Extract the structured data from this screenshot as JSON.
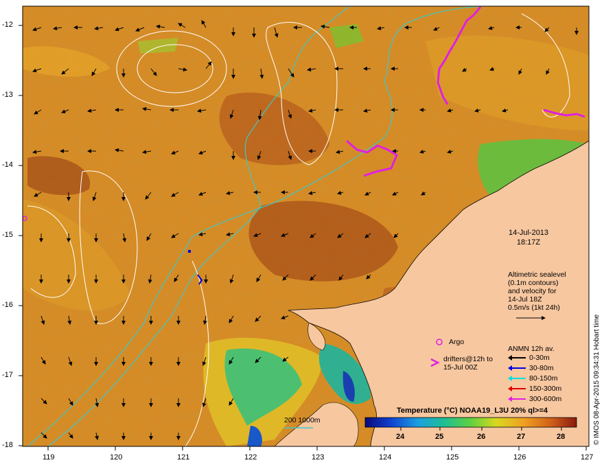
{
  "map": {
    "date": "14-Jul-2013",
    "time": "18:17Z",
    "lon_ticks": [
      "119",
      "120",
      "121",
      "122",
      "123",
      "124",
      "125",
      "126",
      "127"
    ],
    "lat_ticks": [
      "-12",
      "-13",
      "-14",
      "-15",
      "-16",
      "-17",
      "-18"
    ],
    "lon_range": [
      118.6,
      127.0
    ],
    "lat_range": [
      -18.0,
      -11.8
    ]
  },
  "altimetry_note": {
    "line1": "Altimetric sealevel",
    "line2": "(0.1m contours)",
    "line3": "and velocity for",
    "line4": "14-Jul 18Z",
    "line5": "0.5m/s (1kt 24h)"
  },
  "argo": {
    "label": "Argo",
    "color": "#e020e0"
  },
  "drifters": {
    "line1": "drifters@12h to",
    "line2": "15-Jul 00Z",
    "symbol": ">",
    "color": "#e020e0"
  },
  "anmn": {
    "title": "ANMN 12h av.",
    "items": [
      {
        "label": "0-30m",
        "color": "#000000"
      },
      {
        "label": "30-80m",
        "color": "#0000e0"
      },
      {
        "label": "80-150m",
        "color": "#00e0e0"
      },
      {
        "label": "150-300m",
        "color": "#e00000"
      },
      {
        "label": "300-600m",
        "color": "#e020e0"
      }
    ]
  },
  "bathymetry": {
    "label": "200  1000m",
    "color": "#3fc7c7"
  },
  "colorbar": {
    "title": "Temperature (°C) NOAA19_L3U 20% ql>=4",
    "ticks": [
      "24",
      "25",
      "26",
      "27",
      "28"
    ],
    "range": [
      23.1,
      28.5
    ]
  },
  "credit": "© IMOS 08-Apr-2015 09:34:31 Hobart time",
  "colors": {
    "land": "#f7c7a0",
    "sst_base": "#d7861e",
    "warm": "#b3561c",
    "cool": "#33b060"
  }
}
